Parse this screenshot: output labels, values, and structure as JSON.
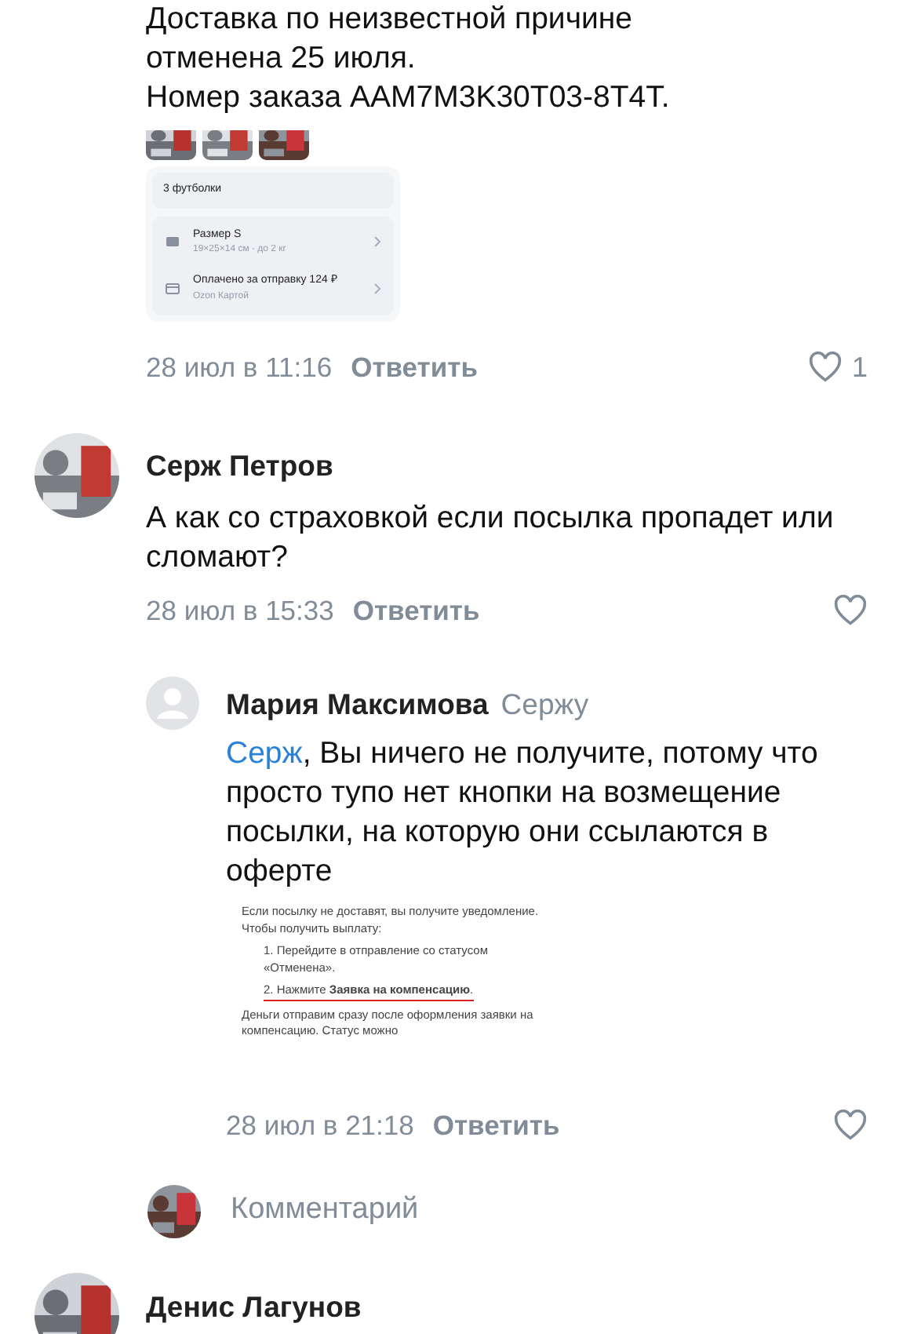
{
  "first_comment": {
    "text_lines": [
      "Доставка по неизвестной причине",
      "отменена 25 июля.",
      "Номер заказа AAM7M3K30T03-8T4T."
    ],
    "attachment": {
      "title": "3 футболки",
      "rows": [
        {
          "kind": "box",
          "title": "Размер S",
          "subtitle": "19×25×14 см · до 2 кг"
        },
        {
          "kind": "card",
          "title": "Оплачено за отправку 124 ₽",
          "subtitle": "Ozon Картой"
        }
      ]
    },
    "date": "28 июл в 11:16",
    "reply_label": "Ответить",
    "liked": false,
    "likes": "1"
  },
  "comment": {
    "author": "Серж Петров",
    "text": "А как со страховкой если посылка пропадет или сломают?",
    "date": "28 июл в 15:33",
    "reply_label": "Ответить",
    "liked": false,
    "replies": [
      {
        "author": "Мария Максимова",
        "reply_to": "Сержу",
        "mention": "Серж",
        "text": ", Вы ничего не получите, потому что просто тупо нет кнопки на возмещение посылки, на которую они ссылаются в оферте",
        "document": {
          "intro": "Если посылку не доставят, вы получите уведомление. Чтобы получить выплату:",
          "steps": [
            {
              "number": "1.",
              "text": "Перейдите в отправление со статусом «Отменена».",
              "underlined": false
            },
            {
              "number": "2.",
              "text": "Нажмите **Заявка на компенсацию**.",
              "underlined": true
            }
          ],
          "outro": "Деньги отправим сразу после оформления заявки на компенсацию. Статус можно"
        },
        "date": "28 июл в 21:18",
        "reply_label": "Ответить",
        "liked": false
      }
    ]
  },
  "comment_input": {
    "placeholder": "Комментарий"
  },
  "next_comment": {
    "author": "Денис Лагунов"
  }
}
